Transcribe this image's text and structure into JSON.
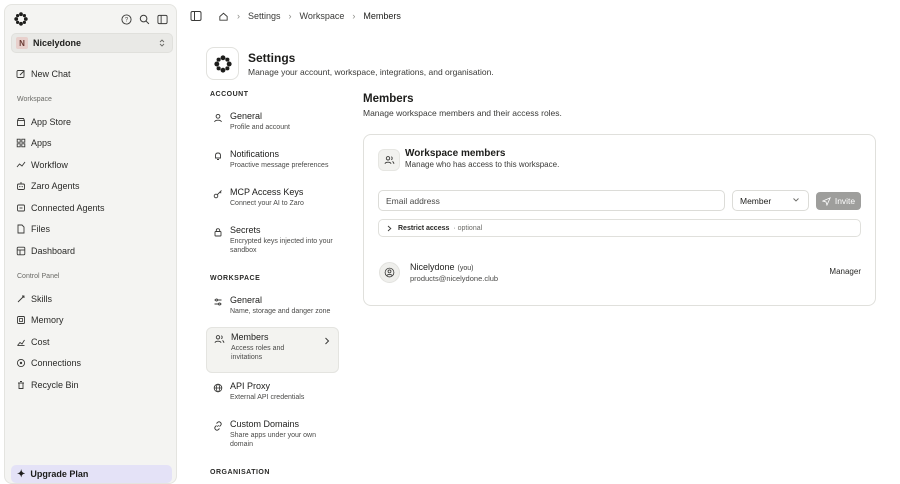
{
  "sidebar": {
    "workspace_badge": "N",
    "workspace_name": "Nicelydone",
    "new_chat": "New Chat",
    "section_workspace": "Workspace",
    "workspace_items": [
      {
        "label": "App Store",
        "icon": "store-icon"
      },
      {
        "label": "Apps",
        "icon": "apps-icon"
      },
      {
        "label": "Workflow",
        "icon": "workflow-icon"
      },
      {
        "label": "Zaro Agents",
        "icon": "agent-icon"
      },
      {
        "label": "Connected Agents",
        "icon": "link-icon"
      },
      {
        "label": "Files",
        "icon": "file-icon"
      },
      {
        "label": "Dashboard",
        "icon": "dashboard-icon"
      }
    ],
    "section_control": "Control Panel",
    "control_items": [
      {
        "label": "Skills",
        "icon": "skills-icon"
      },
      {
        "label": "Memory",
        "icon": "memory-icon"
      },
      {
        "label": "Cost",
        "icon": "cost-icon"
      },
      {
        "label": "Connections",
        "icon": "connections-icon"
      },
      {
        "label": "Recycle Bin",
        "icon": "trash-icon"
      }
    ],
    "upgrade": "Upgrade Plan"
  },
  "breadcrumb": {
    "items": [
      "Settings",
      "Workspace",
      "Members"
    ]
  },
  "settings": {
    "title": "Settings",
    "subtitle": "Manage your account, workspace, integrations, and organisation.",
    "sections": {
      "account": "ACCOUNT",
      "workspace": "WORKSPACE",
      "organisation": "ORGANISATION"
    },
    "account_items": [
      {
        "title": "General",
        "desc": "Profile and account"
      },
      {
        "title": "Notifications",
        "desc": "Proactive message preferences"
      },
      {
        "title": "MCP Access Keys",
        "desc": "Connect your AI to Zaro"
      },
      {
        "title": "Secrets",
        "desc": "Encrypted keys injected into your sandbox"
      }
    ],
    "workspace_items": [
      {
        "title": "General",
        "desc": "Name, storage and danger zone"
      },
      {
        "title": "Members",
        "desc": "Access roles and invitations"
      },
      {
        "title": "API Proxy",
        "desc": "External API credentials"
      },
      {
        "title": "Custom Domains",
        "desc": "Share apps under your own domain"
      }
    ]
  },
  "members": {
    "title": "Members",
    "subtitle": "Manage workspace members and their access roles.",
    "card_title": "Workspace members",
    "card_subtitle": "Manage who has access to this workspace.",
    "email_placeholder": "Email address",
    "role_value": "Member",
    "invite_label": "Invite",
    "restrict_label": "Restrict access",
    "restrict_optional": "· optional",
    "list": [
      {
        "name": "Nicelydone",
        "tag": "(you)",
        "email": "products@nicelydone.club",
        "role": "Manager"
      }
    ]
  }
}
